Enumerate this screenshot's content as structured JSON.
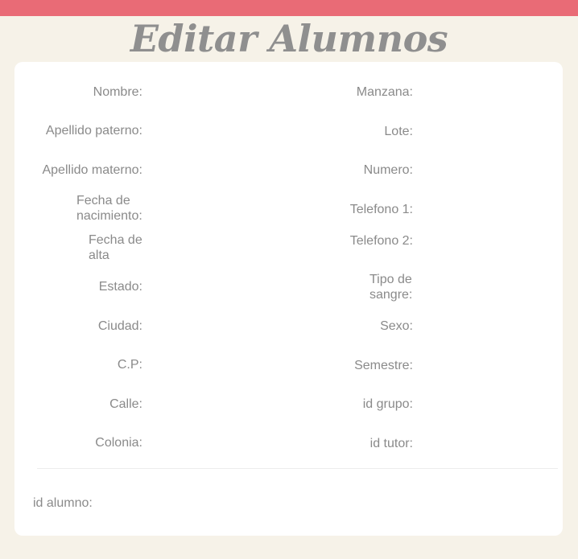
{
  "header": {
    "accent_color": "#e96b76",
    "title": "Editar Alumnos"
  },
  "form": {
    "left": [
      {
        "label": "Nombre:",
        "value": ""
      },
      {
        "label": "Apellido paterno:",
        "value": ""
      },
      {
        "label": "Apellido materno:",
        "value": ""
      },
      {
        "label": "Fecha de nacimiento:",
        "value": ""
      },
      {
        "label": "Fecha de alta",
        "value": ""
      },
      {
        "label": "Estado:",
        "value": ""
      },
      {
        "label": "Ciudad:",
        "value": ""
      },
      {
        "label": "C.P:",
        "value": ""
      },
      {
        "label": "Calle:",
        "value": ""
      },
      {
        "label": "Colonia:",
        "value": ""
      }
    ],
    "right": [
      {
        "label": "Manzana:",
        "value": ""
      },
      {
        "label": "Lote:",
        "value": ""
      },
      {
        "label": "Numero:",
        "value": ""
      },
      {
        "label": "Telefono 1:",
        "value": ""
      },
      {
        "label": "Telefono 2:",
        "value": ""
      },
      {
        "label": "Tipo de sangre:",
        "value": ""
      },
      {
        "label": "Sexo:",
        "value": ""
      },
      {
        "label": "Semestre:",
        "value": ""
      },
      {
        "label": "id grupo:",
        "value": ""
      },
      {
        "label": "id tutor:",
        "value": ""
      }
    ],
    "footer": {
      "label": "id alumno:",
      "value": ""
    }
  }
}
